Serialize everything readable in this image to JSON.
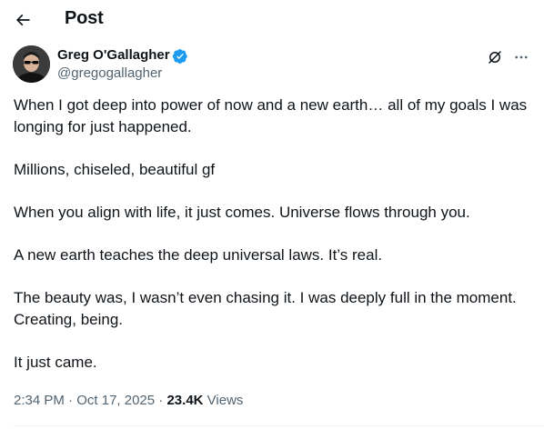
{
  "header": {
    "title": "Post",
    "back_icon": "arrow-left-icon"
  },
  "author": {
    "display_name": "Greg O'Gallagher",
    "handle": "@gregogallagher",
    "verified": true,
    "verified_color": "#1d9bf0"
  },
  "actions": {
    "grok_icon": "grok-icon",
    "more_icon": "more-horizontal-icon"
  },
  "post": {
    "paragraphs": [
      "When I got deep into power of now and a new earth… all of my goals I was longing for just happened.",
      "Millions, chiseled, beautiful gf",
      "When you align with life, it just comes. Universe flows through you.",
      "A new earth teaches the deep universal laws. It’s real.",
      "The beauty was, I wasn’t even chasing it. I was deeply full in the moment. Creating, being.",
      "It just came."
    ]
  },
  "meta": {
    "time": "2:34 PM",
    "separator": "·",
    "date": "Oct 17, 2025",
    "views_count": "23.4K",
    "views_label": "Views"
  },
  "colors": {
    "text_primary": "#0f1419",
    "text_secondary": "#536471",
    "divider": "#eff3f4"
  }
}
